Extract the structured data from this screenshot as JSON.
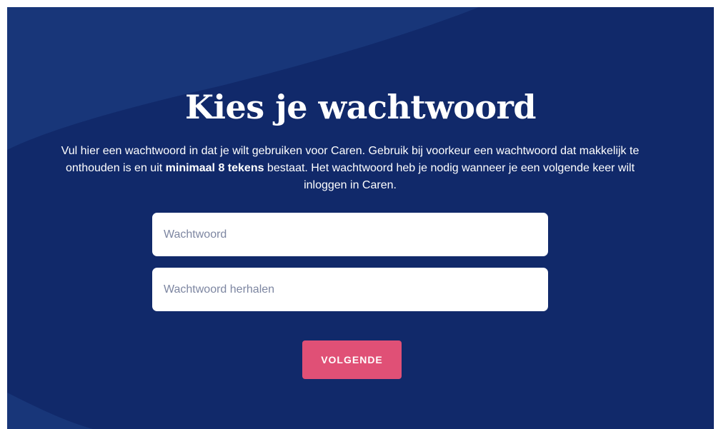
{
  "heading": "Kies je wachtwoord",
  "intro": {
    "before": "Vul hier een wachtwoord in dat je wilt gebruiken voor Caren. Gebruik bij voorkeur een wachtwoord dat makkelijk te onthouden is en uit ",
    "emphasis": "minimaal 8 tekens",
    "after": " bestaat. Het wachtwoord heb je nodig wanneer je een volgende keer wilt inloggen in Caren."
  },
  "form": {
    "password_placeholder": "Wachtwoord",
    "password_value": "",
    "repeat_placeholder": "Wachtwoord herhalen",
    "repeat_value": "",
    "submit_label": "VOLGENDE"
  },
  "colors": {
    "background": "#11296a",
    "wave": "#1a3880",
    "button": "#e05076",
    "text": "#ffffff"
  }
}
